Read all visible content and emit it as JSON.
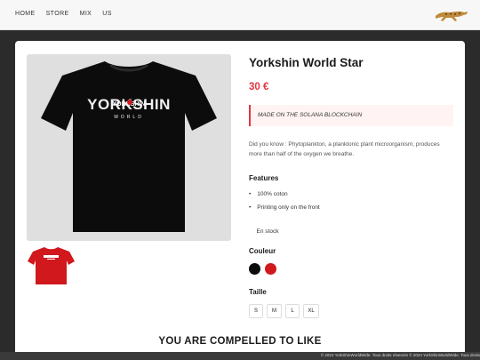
{
  "nav": {
    "home": "HOME",
    "store": "STORE",
    "mix": "MIX",
    "us": "US"
  },
  "logo_icon": "cheetah-logo",
  "product": {
    "title": "Yorkshin World Star",
    "price": "30 €",
    "callout": "MADE ON THE SOLANA BLOCKCHAIN",
    "description": "Did you know : Phytoplankton, a planktonic plant microorganism, produces more than half of the oxygen we breathe.",
    "print_main": "YORKSHIN",
    "print_sub": "WORLD",
    "features_heading": "Features",
    "features": [
      "100% coton",
      "Printing only on the front"
    ],
    "stock": "En stock",
    "color_heading": "Couleur",
    "colors": [
      {
        "name": "black",
        "hex": "#0c0c0c"
      },
      {
        "name": "red",
        "hex": "#d0181d"
      }
    ],
    "size_heading": "Taille",
    "sizes": [
      "S",
      "M",
      "L",
      "XL"
    ]
  },
  "related_heading": "YOU ARE COMPELLED TO LIKE",
  "footer": "© 2024 YorkShinWorldWide. Tous droits réservés © 2024 YorkShinWorldWide. Tous droits"
}
